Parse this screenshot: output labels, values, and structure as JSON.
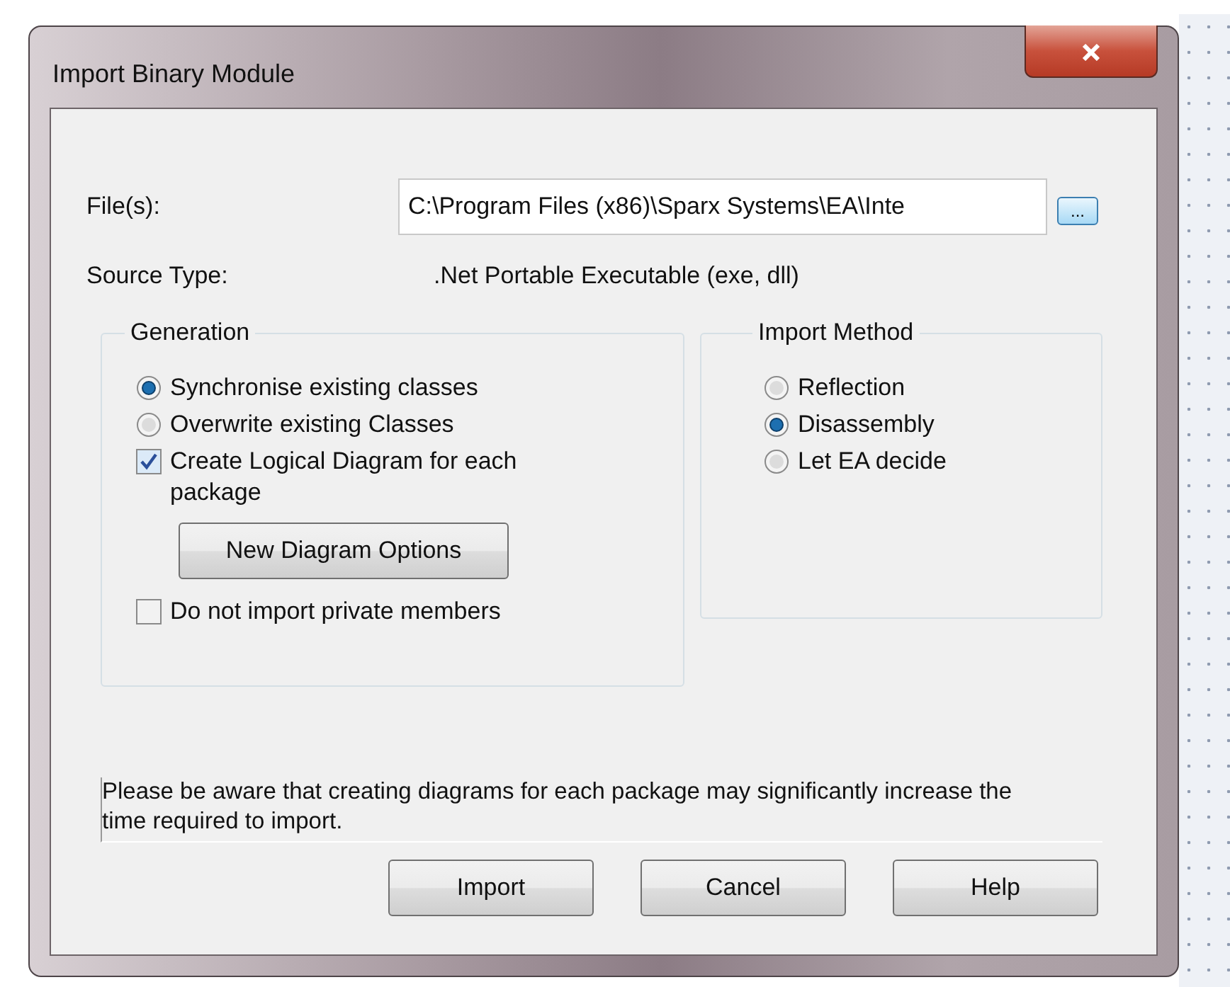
{
  "window": {
    "title": "Import Binary Module"
  },
  "files": {
    "label": "File(s):",
    "value": "C:\\Program Files (x86)\\Sparx Systems\\EA\\Inte",
    "browse_button": "..."
  },
  "source_type": {
    "label": "Source Type:",
    "value": ".Net Portable Executable (exe, dll)"
  },
  "generation": {
    "title": "Generation",
    "items": [
      {
        "kind": "radio",
        "label": "Synchronise existing classes",
        "selected": true
      },
      {
        "kind": "radio",
        "label": "Overwrite existing Classes",
        "selected": false
      },
      {
        "kind": "checkbox",
        "label": "Create Logical Diagram for each package",
        "checked": true
      },
      {
        "kind": "button",
        "label": "New Diagram Options"
      },
      {
        "kind": "checkbox",
        "label": "Do not import private members",
        "checked": false
      }
    ]
  },
  "import_method": {
    "title": "Import Method",
    "items": [
      {
        "kind": "radio",
        "label": "Reflection",
        "selected": false
      },
      {
        "kind": "radio",
        "label": "Disassembly",
        "selected": true
      },
      {
        "kind": "radio",
        "label": "Let EA decide",
        "selected": false
      }
    ]
  },
  "note": "Please be aware that creating diagrams for each package may significantly increase the time required to import.",
  "buttons": [
    "Import",
    "Cancel",
    "Help"
  ]
}
